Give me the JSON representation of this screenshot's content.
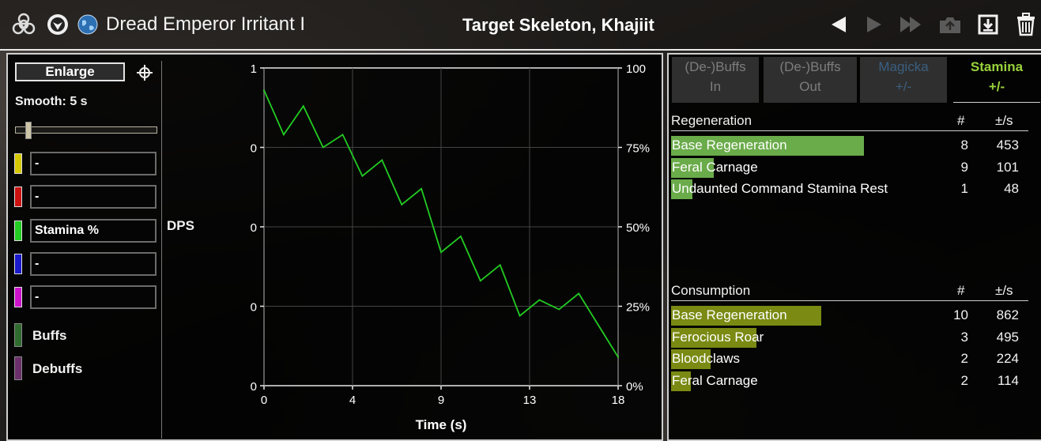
{
  "title_bar": {
    "character_name": "Dread Emperor Irritant I",
    "target_name": "Target Skeleton, Khajiit",
    "icons": [
      "biohazard-icon",
      "class-emblem-icon",
      "globe-icon"
    ],
    "nav_icons": [
      "previous-fight-icon",
      "next-fight-icon",
      "last-fight-icon",
      "save-icon",
      "import-icon",
      "trash-icon"
    ]
  },
  "left_panel": {
    "enlarge_label": "Enlarge",
    "smooth_label": "Smooth: 5 s",
    "smooth_value_s": 5,
    "selectors": [
      {
        "color": "#d6c800",
        "label": "-"
      },
      {
        "color": "#cc1111",
        "label": "-"
      },
      {
        "color": "#22cc22",
        "label": "Stamina %"
      },
      {
        "color": "#1a1acc",
        "label": "-"
      },
      {
        "color": "#cc11cc",
        "label": "-"
      }
    ],
    "buffs_label": "Buffs",
    "buffs_color": "#2f6b2f",
    "debuffs_label": "Debuffs",
    "debuffs_color": "#6b2f6b",
    "dps_label": "DPS"
  },
  "chart_data": {
    "type": "line",
    "xlabel": "Time (s)",
    "x_ticks": [
      "0",
      "4",
      "9",
      "13",
      "18"
    ],
    "x_tick_values": [
      0,
      4.5,
      9,
      13.5,
      18
    ],
    "xlim": [
      0,
      18
    ],
    "y_left_ticks": [
      "1",
      "0",
      "0",
      "0",
      "0"
    ],
    "y_right_ticks": [
      "100",
      "75%",
      "50%",
      "25%",
      "0%"
    ],
    "ylim": [
      0,
      100
    ],
    "grid": true,
    "series": [
      {
        "name": "Stamina %",
        "color": "#22cc22",
        "x": [
          0,
          1.0,
          2.0,
          3.0,
          4.0,
          5.0,
          6.0,
          7.0,
          8.0,
          9.0,
          10.0,
          11.0,
          12.0,
          13.0,
          14.0,
          15.0,
          16.0,
          18.0
        ],
        "y": [
          93,
          79,
          88,
          75,
          79,
          66,
          71,
          57,
          62,
          42,
          47,
          33,
          38,
          22,
          27,
          24,
          29,
          9
        ]
      }
    ]
  },
  "right_panel": {
    "tabs": [
      {
        "line1": "(De-)Buffs",
        "line2": "In",
        "active": false,
        "color": "#7d7d7d"
      },
      {
        "line1": "(De-)Buffs",
        "line2": "Out",
        "active": false,
        "color": "#7d7d7d"
      },
      {
        "line1": "Magicka",
        "line2": "+/-",
        "active": false,
        "color": "#3a5f80"
      },
      {
        "line1": "Stamina",
        "line2": "+/-",
        "active": true,
        "color": "#98d23c"
      }
    ],
    "regeneration": {
      "header": "Regeneration",
      "count_header": "#",
      "rate_header": "±/s",
      "bar_color": "#6aab4a",
      "rows": [
        {
          "name": "Base Regeneration",
          "count": "8",
          "rate": "453",
          "share": 0.54
        },
        {
          "name": "Feral Carnage",
          "count": "9",
          "rate": "101",
          "share": 0.12
        },
        {
          "name": "Undaunted Command Stamina Rest",
          "count": "1",
          "rate": "48",
          "share": 0.06
        }
      ]
    },
    "consumption": {
      "header": "Consumption",
      "count_header": "#",
      "rate_header": "±/s",
      "bar_color": "#7a8a12",
      "rows": [
        {
          "name": "Base Regeneration",
          "count": "10",
          "rate": "862",
          "share": 0.42
        },
        {
          "name": "Ferocious Roar",
          "count": "3",
          "rate": "495",
          "share": 0.24
        },
        {
          "name": "Bloodclaws",
          "count": "2",
          "rate": "224",
          "share": 0.11
        },
        {
          "name": "Feral Carnage",
          "count": "2",
          "rate": "114",
          "share": 0.055
        }
      ]
    }
  }
}
